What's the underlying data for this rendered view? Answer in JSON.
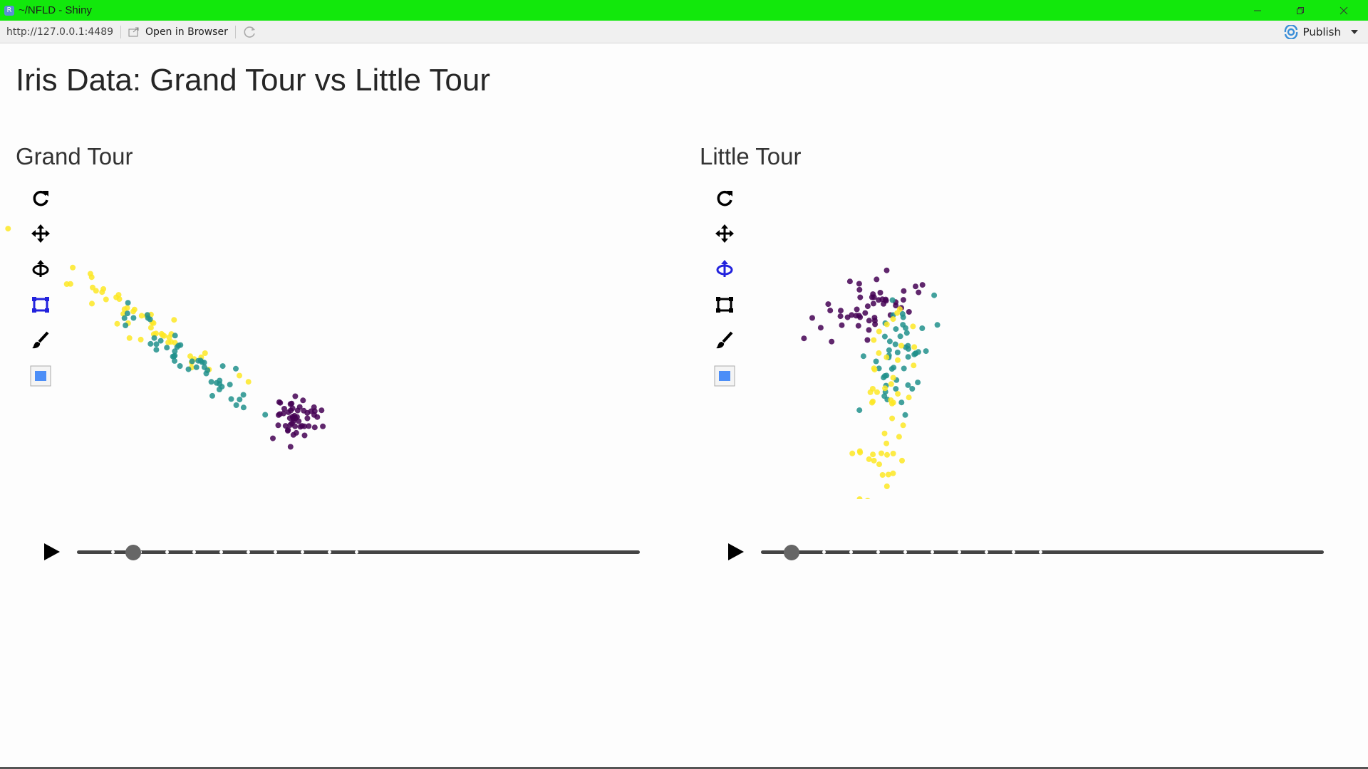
{
  "window": {
    "title": "~/NFLD - Shiny",
    "app_icon": "R",
    "controls": [
      "minimize-icon",
      "restore-icon",
      "close-icon"
    ]
  },
  "addressbar": {
    "url": "http://127.0.0.1:4489",
    "open_in_browser": "Open in Browser",
    "publish": "Publish"
  },
  "page": {
    "title": "Iris Data: Grand Tour vs Little Tour"
  },
  "colors": {
    "setosa": "#440154",
    "versicolor": "#21908c",
    "virginica": "#fde725",
    "active_tool": "#2222dd",
    "titlebar": "#12e80c"
  },
  "panels": [
    {
      "title": "Grand Tour",
      "active_tool": "select-box",
      "tools": [
        "reset-icon",
        "pan-icon",
        "rotate-icon",
        "select-box-icon",
        "brush-icon",
        "color-swatch-icon"
      ],
      "slider": {
        "position_fraction": 0.1,
        "ticks": 10
      }
    },
    {
      "title": "Little Tour",
      "active_tool": "rotate",
      "tools": [
        "reset-icon",
        "pan-icon",
        "rotate-icon",
        "select-box-icon",
        "brush-icon",
        "color-swatch-icon"
      ],
      "slider": {
        "position_fraction": 0.055,
        "ticks": 10
      }
    }
  ]
}
